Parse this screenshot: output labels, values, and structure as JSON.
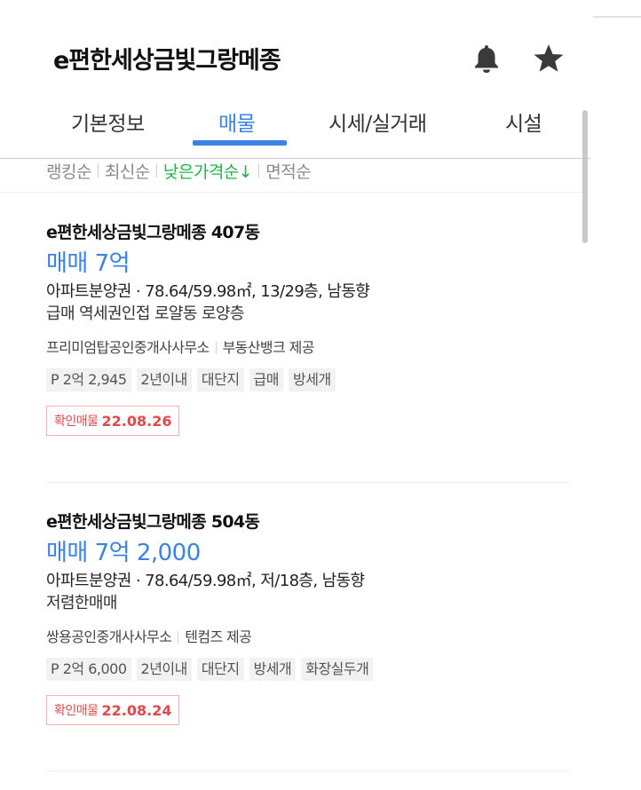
{
  "header": {
    "title": "e편한세상금빛그랑메종",
    "bell_icon": "bell-icon",
    "star_icon": "star-icon"
  },
  "tabs": [
    {
      "label": "기본정보",
      "active": false
    },
    {
      "label": "매물",
      "active": true
    },
    {
      "label": "시세/실거래",
      "active": false
    },
    {
      "label": "시설",
      "active": false
    }
  ],
  "sort_options": [
    {
      "label": "랭킹순",
      "active": false
    },
    {
      "label": "최신순",
      "active": false
    },
    {
      "label": "낮은가격순↓",
      "active": true
    },
    {
      "label": "면적순",
      "active": false
    }
  ],
  "listings": [
    {
      "title": "e편한세상금빛그랑메종 407동",
      "price": "매매 7억",
      "spec": "아파트분양권 · 78.64/59.98㎡, 13/29층, 남동향",
      "description": "급매 역세권인접 로얄동 로양층",
      "agent": "프리미엄탑공인중개사사무소",
      "provider": "부동산뱅크 제공",
      "tags": [
        "P 2억 2,945",
        "2년이내",
        "대단지",
        "급매",
        "방세개"
      ],
      "verified_label": "확인매물",
      "verified_date": "22.08.26"
    },
    {
      "title": "e편한세상금빛그랑메종 504동",
      "price": "매매 7억 2,000",
      "spec": "아파트분양권 · 78.64/59.98㎡, 저/18층, 남동향",
      "description": "저렴한매매",
      "agent": "쌍용공인중개사사무소",
      "provider": "텐컴즈 제공",
      "tags": [
        "P 2억 6,000",
        "2년이내",
        "대단지",
        "방세개",
        "화장실두개"
      ],
      "verified_label": "확인매물",
      "verified_date": "22.08.24"
    }
  ],
  "colors": {
    "accent": "#3b82e6",
    "sort_active": "#22b14c",
    "verified": "#e0484a"
  }
}
